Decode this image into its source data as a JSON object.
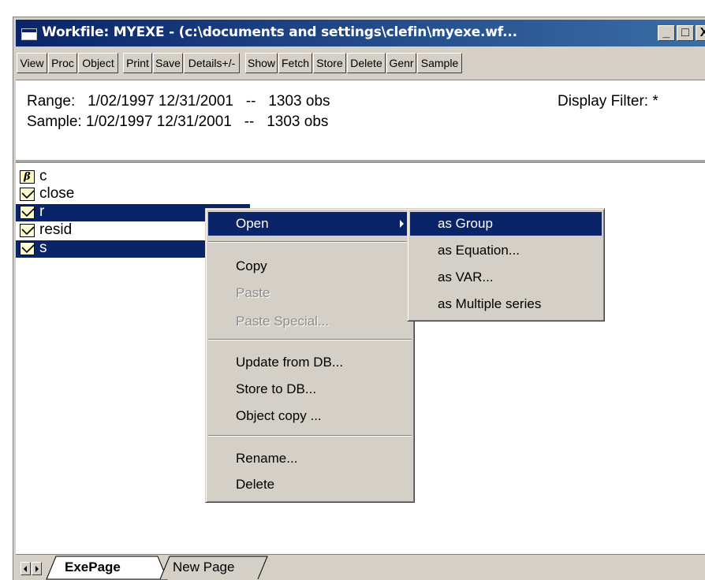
{
  "window": {
    "title": "Workfile: MYEXE - (c:\\documents and settings\\clefin\\myexe.wf...",
    "controls": {
      "minimize": "_",
      "maximize": "□",
      "close": "X"
    }
  },
  "toolbar": {
    "buttons": [
      "View",
      "Proc",
      "Object",
      "Print",
      "Save",
      "Details+/-",
      "Show",
      "Fetch",
      "Store",
      "Delete",
      "Genr",
      "Sample"
    ]
  },
  "info": {
    "range_line": "Range:   1/02/1997 12/31/2001   --   1303 obs",
    "sample_line": "Sample: 1/02/1997 12/31/2001   --   1303 obs",
    "display_filter": "Display Filter: *"
  },
  "objects": [
    {
      "name": "c",
      "icon": "coefficient-icon",
      "icon_glyph": "β",
      "selected": false
    },
    {
      "name": "close",
      "icon": "series-icon",
      "selected": false
    },
    {
      "name": "r",
      "icon": "series-icon",
      "selected": true
    },
    {
      "name": "resid",
      "icon": "series-icon",
      "selected": false
    },
    {
      "name": "s",
      "icon": "series-icon",
      "selected": true
    }
  ],
  "context_menu": {
    "open": "Open",
    "copy": "Copy",
    "paste": "Paste",
    "paste_special": "Paste Special...",
    "update_from_db": "Update from DB...",
    "store_to_db": "Store to DB...",
    "object_copy": "Object copy ...",
    "rename": "Rename...",
    "delete": "Delete"
  },
  "submenu": {
    "as_group": "as Group",
    "as_equation": "as Equation...",
    "as_var": "as VAR...",
    "as_multiple_series": "as Multiple series"
  },
  "tabs": [
    {
      "label": "ExePage",
      "active": true
    },
    {
      "label": "New Page",
      "active": false
    }
  ],
  "colors": {
    "selection": "#0a246a",
    "chrome": "#d4d0c8",
    "title_gradient_end": "#3a6ea5"
  }
}
